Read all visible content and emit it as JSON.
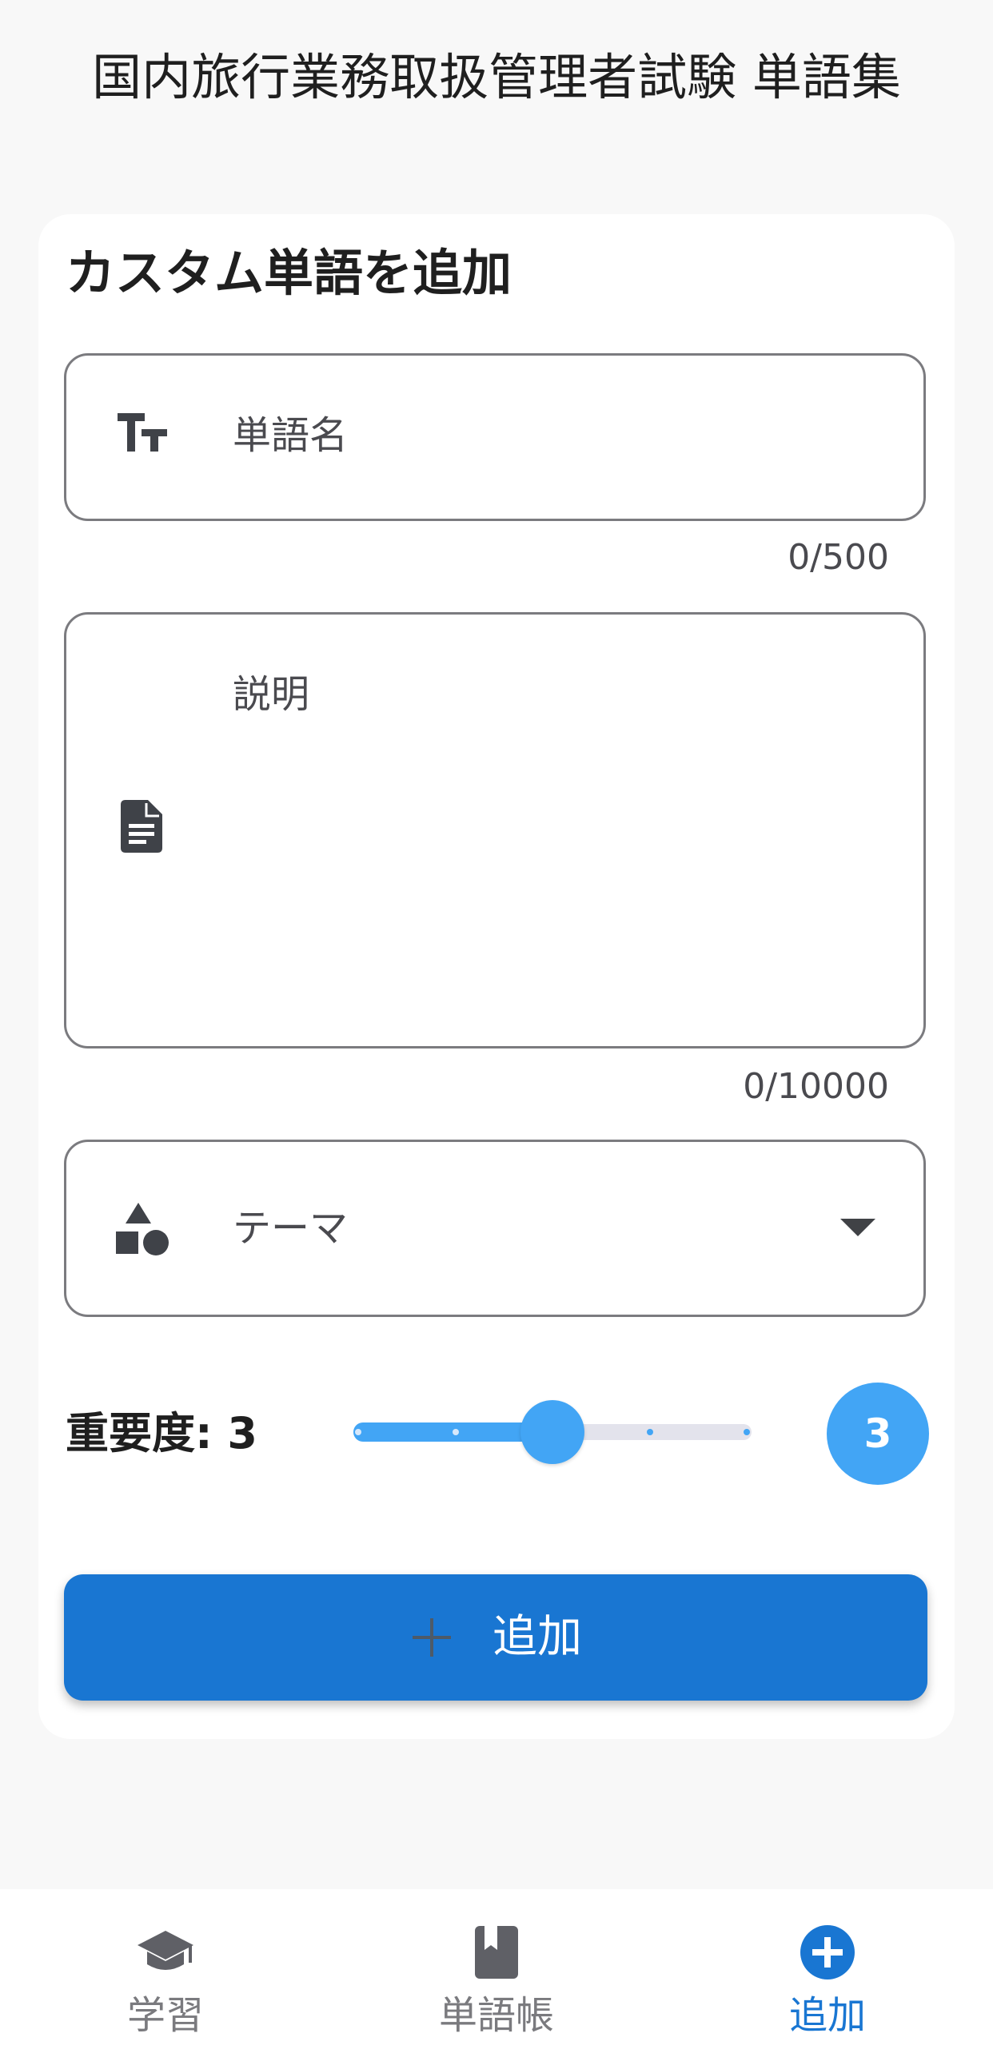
{
  "header": {
    "title": "国内旅行業務取扱管理者試験 単語集"
  },
  "form": {
    "title": "カスタム単語を追加",
    "term": {
      "label": "単語名",
      "value": "",
      "counter": "0/500",
      "icon": "text-fields-icon"
    },
    "description": {
      "label": "説明",
      "value": "",
      "counter": "0/10000",
      "icon": "description-icon"
    },
    "theme": {
      "label": "テーマ",
      "selected": "",
      "icon": "category-shapes-icon"
    },
    "importance": {
      "label": "重要度: 3",
      "value": 3,
      "min": 1,
      "max": 5,
      "badge": "3"
    },
    "submit": {
      "label": "追加",
      "icon": "plus-icon"
    }
  },
  "bottom_nav": {
    "items": [
      {
        "label": "学習",
        "icon": "school-icon",
        "active": false
      },
      {
        "label": "単語帳",
        "icon": "book-icon",
        "active": false
      },
      {
        "label": "追加",
        "icon": "add-circle-icon",
        "active": true
      }
    ]
  },
  "colors": {
    "primary": "#1976d2",
    "accent": "#42a5f5",
    "background": "#f8f8f8",
    "card": "#ffffff",
    "outline": "#7b7b7f"
  }
}
